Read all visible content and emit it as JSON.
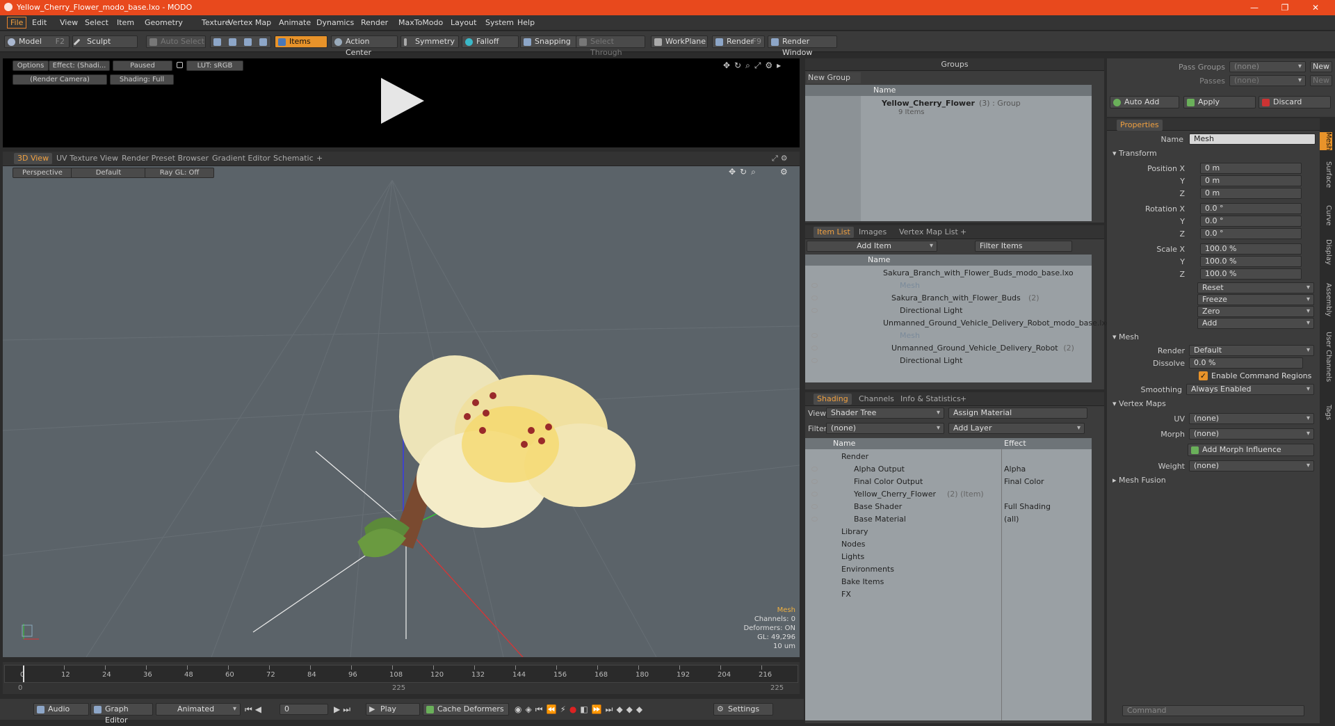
{
  "window": {
    "title": "Yellow_Cherry_Flower_modo_base.lxo - MODO",
    "controls": [
      "—",
      "❐",
      "✕"
    ]
  },
  "menu": [
    "File",
    "Edit",
    "View",
    "Select",
    "Item",
    "Geometry",
    "Texture",
    "Vertex Map",
    "Animate",
    "Dynamics",
    "Render",
    "MaxToModo",
    "Layout",
    "System",
    "Help"
  ],
  "toolbar": {
    "model": "Model",
    "model_key": "F2",
    "sculpt": "Sculpt",
    "auto_select": "Auto Select",
    "items": "Items",
    "action_center": "Action Center",
    "symmetry": "Symmetry",
    "falloff": "Falloff",
    "snapping": "Snapping",
    "select_through": "Select Through",
    "workplane": "WorkPlane",
    "render": "Render",
    "render_key": "F9",
    "render_window": "Render Window"
  },
  "preview": {
    "options": "Options",
    "effect": "Effect: (Shadi...",
    "paused": "Paused",
    "lut": "LUT: sRGB",
    "camera": "(Render Camera)",
    "shading": "Shading: Full"
  },
  "viewport": {
    "tabs": [
      "3D View",
      "UV Texture View",
      "Render Preset Browser",
      "Gradient Editor",
      "Schematic",
      "+"
    ],
    "perspective": "Perspective",
    "default": "Default",
    "raygl": "Ray GL: Off",
    "info": {
      "title": "Mesh",
      "channels": "Channels: 0",
      "deformers": "Deformers: ON",
      "gl": "GL: 49,296",
      "units": "10 um"
    }
  },
  "timeline": {
    "ticks": [
      "0",
      "12",
      "24",
      "36",
      "48",
      "60",
      "72",
      "84",
      "96",
      "108",
      "120",
      "132",
      "144",
      "156",
      "168",
      "180",
      "192",
      "204",
      "216"
    ],
    "sub_left": "0",
    "sub_mid": "225",
    "sub_right": "225"
  },
  "bottom": {
    "audio": "Audio",
    "graph_editor": "Graph Editor",
    "animated": "Animated",
    "frame": "0",
    "play": "Play",
    "cache": "Cache Deformers",
    "settings": "Settings",
    "command": "Command"
  },
  "groups": {
    "header": "Groups",
    "new_group": "New Group",
    "col_name": "Name",
    "item_name": "Yellow_Cherry_Flower",
    "item_count": "(3)",
    "item_type": ": Group",
    "item_sub": "9 Items"
  },
  "itemlist": {
    "tabs": [
      "Item List",
      "Images",
      "Vertex Map List",
      "+"
    ],
    "add_item": "Add Item",
    "filter": "Filter Items",
    "col_name": "Name",
    "rows": [
      {
        "label": "Sakura_Branch_with_Flower_Buds_modo_base.lxo",
        "indent": 0,
        "dim": false,
        "eye": false
      },
      {
        "label": "Mesh",
        "indent": 2,
        "dim": true,
        "eye": true
      },
      {
        "label": "Sakura_Branch_with_Flower_Buds",
        "count": "(2)",
        "indent": 1,
        "dim": false,
        "eye": true
      },
      {
        "label": "Directional Light",
        "indent": 2,
        "dim": false,
        "eye": true
      },
      {
        "label": "Unmanned_Ground_Vehicle_Delivery_Robot_modo_base.lxo",
        "indent": 0,
        "dim": false,
        "eye": false
      },
      {
        "label": "Mesh",
        "indent": 2,
        "dim": true,
        "eye": true
      },
      {
        "label": "Unmanned_Ground_Vehicle_Delivery_Robot",
        "count": "(2)",
        "indent": 1,
        "dim": false,
        "eye": true
      },
      {
        "label": "Directional Light",
        "indent": 2,
        "dim": false,
        "eye": true
      }
    ]
  },
  "shading": {
    "tabs": [
      "Shading",
      "Channels",
      "Info & Statistics",
      "+"
    ],
    "view_label": "View",
    "view_value": "Shader Tree",
    "assign": "Assign Material",
    "filter_label": "Filter",
    "filter_value": "(none)",
    "add_layer": "Add Layer",
    "col_name": "Name",
    "col_effect": "Effect",
    "rows": [
      {
        "label": "Render",
        "effect": "",
        "indent": 0,
        "eye": false
      },
      {
        "label": "Alpha Output",
        "effect": "Alpha",
        "indent": 1,
        "eye": true
      },
      {
        "label": "Final Color Output",
        "effect": "Final Color",
        "indent": 1,
        "eye": true
      },
      {
        "label": "Yellow_Cherry_Flower",
        "extra": "(2) (Item)",
        "effect": "",
        "indent": 1,
        "eye": true
      },
      {
        "label": "Base Shader",
        "effect": "Full Shading",
        "indent": 1,
        "eye": true
      },
      {
        "label": "Base Material",
        "effect": "(all)",
        "indent": 1,
        "eye": true
      },
      {
        "label": "Library",
        "effect": "",
        "indent": 0,
        "eye": false
      },
      {
        "label": "Nodes",
        "effect": "",
        "indent": 0,
        "eye": false
      },
      {
        "label": "Lights",
        "effect": "",
        "indent": 0,
        "eye": false
      },
      {
        "label": "Environments",
        "effect": "",
        "indent": 0,
        "eye": false
      },
      {
        "label": "Bake Items",
        "effect": "",
        "indent": 0,
        "eye": false
      },
      {
        "label": "FX",
        "effect": "",
        "indent": 0,
        "eye": false
      }
    ]
  },
  "passes": {
    "pass_groups": "Pass Groups",
    "passes": "Passes",
    "none": "(none)",
    "new": "New",
    "auto_add": "Auto Add",
    "apply": "Apply",
    "discard": "Discard"
  },
  "properties": {
    "tab": "Properties",
    "name_label": "Name",
    "name_value": "Mesh",
    "transform": "Transform",
    "position_label": "Position X",
    "rotation_label": "Rotation X",
    "scale_label": "Scale X",
    "y": "Y",
    "z": "Z",
    "pos": [
      "0 m",
      "0 m",
      "0 m"
    ],
    "rot": [
      "0.0 °",
      "0.0 °",
      "0.0 °"
    ],
    "scale": [
      "100.0 %",
      "100.0 %",
      "100.0 %"
    ],
    "reset": "Reset",
    "freeze": "Freeze",
    "zero": "Zero",
    "add": "Add",
    "mesh": "Mesh",
    "render_label": "Render",
    "render_value": "Default",
    "dissolve_label": "Dissolve",
    "dissolve_value": "0.0 %",
    "cmd_regions": "Enable Command Regions",
    "smoothing_label": "Smoothing",
    "smoothing_value": "Always Enabled",
    "vertex_maps": "Vertex Maps",
    "uv_label": "UV",
    "uv_value": "(none)",
    "morph_label": "Morph",
    "morph_value": "(none)",
    "add_morph": "Add Morph Influence",
    "weight_label": "Weight",
    "weight_value": "(none)",
    "mesh_fusion": "Mesh Fusion",
    "side_tabs": [
      "Mesh",
      "Surface",
      "Curve",
      "Display",
      "Assembly",
      "User Channels",
      "Tags"
    ]
  },
  "colors": {
    "accent": "#e8491d",
    "orange": "#e8932a",
    "viewport": "#5b6369"
  }
}
